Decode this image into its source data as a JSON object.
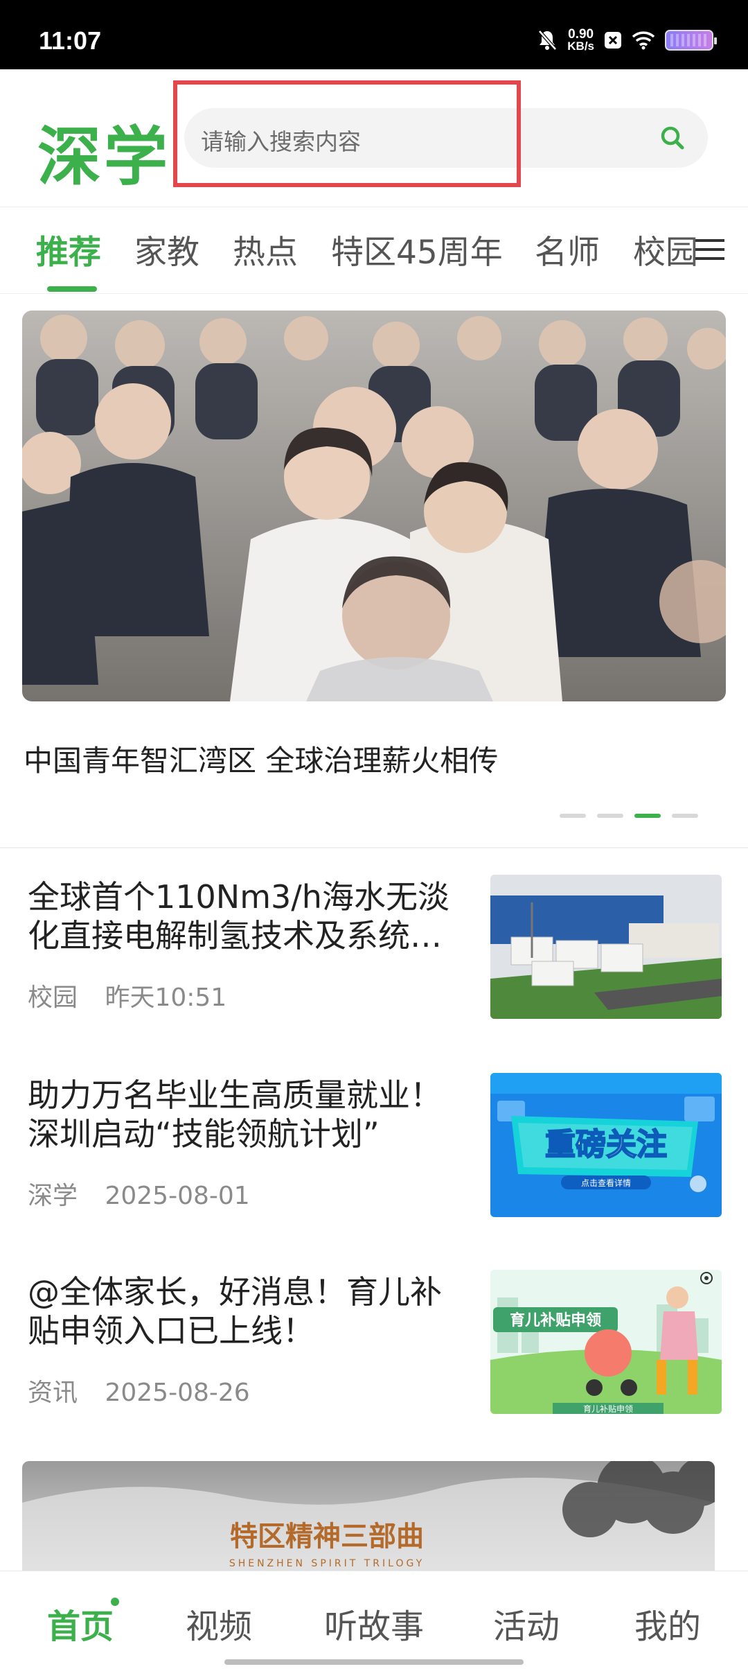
{
  "status_bar": {
    "time": "11:07",
    "net_speed_value": "0.90",
    "net_speed_unit": "KB/s"
  },
  "header": {
    "logo": "深学",
    "search_placeholder": "请输入搜索内容",
    "accent_color": "#3cb04a",
    "highlight_color": "#e2474d"
  },
  "tabs": [
    {
      "label": "推荐",
      "active": true
    },
    {
      "label": "家教"
    },
    {
      "label": "热点"
    },
    {
      "label": "特区45周年"
    },
    {
      "label": "名师"
    },
    {
      "label": "校园"
    }
  ],
  "banner": {
    "caption": "中国青年智汇湾区 全球治理薪火相传",
    "slides_count": 4,
    "active_slide": 3
  },
  "news": [
    {
      "title": "全球首个110Nm3/h海水无淡化直接电解制氢技术及系统…",
      "source": "校园",
      "time": "昨天10:51"
    },
    {
      "title": "助力万名毕业生高质量就业！深圳启动“技能领航计划”",
      "source": "深学",
      "time": "2025-08-01",
      "thumb_text": "重磅关注",
      "thumb_sub": "点击查看详情"
    },
    {
      "title": "@全体家长，好消息！育儿补贴申领入口已上线！",
      "source": "资讯",
      "time": "2025-08-26",
      "thumb_text": "育儿补贴申领",
      "thumb_sub": "育儿补贴申领"
    }
  ],
  "promo": {
    "title": "特区精神三部曲",
    "subtitle": "SHENZHEN SPIRIT TRILOGY"
  },
  "bottom_nav": [
    {
      "label": "首页",
      "active": true
    },
    {
      "label": "视频"
    },
    {
      "label": "听故事"
    },
    {
      "label": "活动"
    },
    {
      "label": "我的"
    }
  ]
}
